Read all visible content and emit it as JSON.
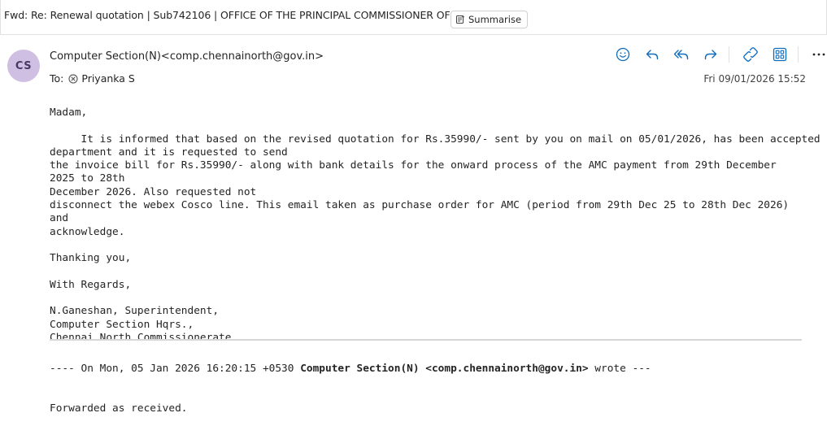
{
  "header": {
    "subject": "Fwd: Re: Renewal quotation | Sub742106 | OFFICE OF THE PRINCIPAL COMMISSIONER OF GST",
    "summarise_label": "Summarise"
  },
  "message": {
    "avatar_initials": "CS",
    "sender": "Computer Section(N)<comp.chennainorth@gov.in>",
    "to_label": "To:",
    "recipient": "Priyanka S",
    "timestamp": "Fri 09/01/2026 15:52",
    "actions": [
      "emoji-react",
      "reply",
      "reply-all",
      "forward",
      "link",
      "apps",
      "more"
    ]
  },
  "body": {
    "greeting": "Madam,",
    "para1_line1": "     It is informed that based on the revised quotation for Rs.35990/- sent by you on mail on 05/01/2026, has been accepted by the",
    "para1_line2": "department and it is requested to send",
    "para1_line3": "the invoice bill for Rs.35990/- along with bank details for the onward process of the AMC payment from 29th December 2025 to 28th",
    "para1_line4": "December 2026. Also requested not",
    "para1_line5": "disconnect the webex Cosco line. This email taken as purchase order for AMC (period from 29th Dec 25 to 28th Dec 2026) and",
    "para1_line6": "acknowledge.",
    "thanks": "Thanking you,",
    "regards": "With Regards,",
    "sig1": "N.Ganeshan, Superintendent,",
    "sig2": "Computer Section Hqrs.,",
    "sig3": "Chennai North Commissionerate."
  },
  "quoted": {
    "prefix": "---- On Mon, 05 Jan 2026 16:20:15 +0530 ",
    "author": "Computer Section(N) <comp.chennainorth@gov.in>",
    "suffix": " wrote ---",
    "forwarded": "Forwarded as received."
  },
  "colors": {
    "accent": "#0f6cbd",
    "avatar_bg": "#cfbfe3",
    "avatar_fg": "#4b3766",
    "divider": "#d6d6d6"
  }
}
